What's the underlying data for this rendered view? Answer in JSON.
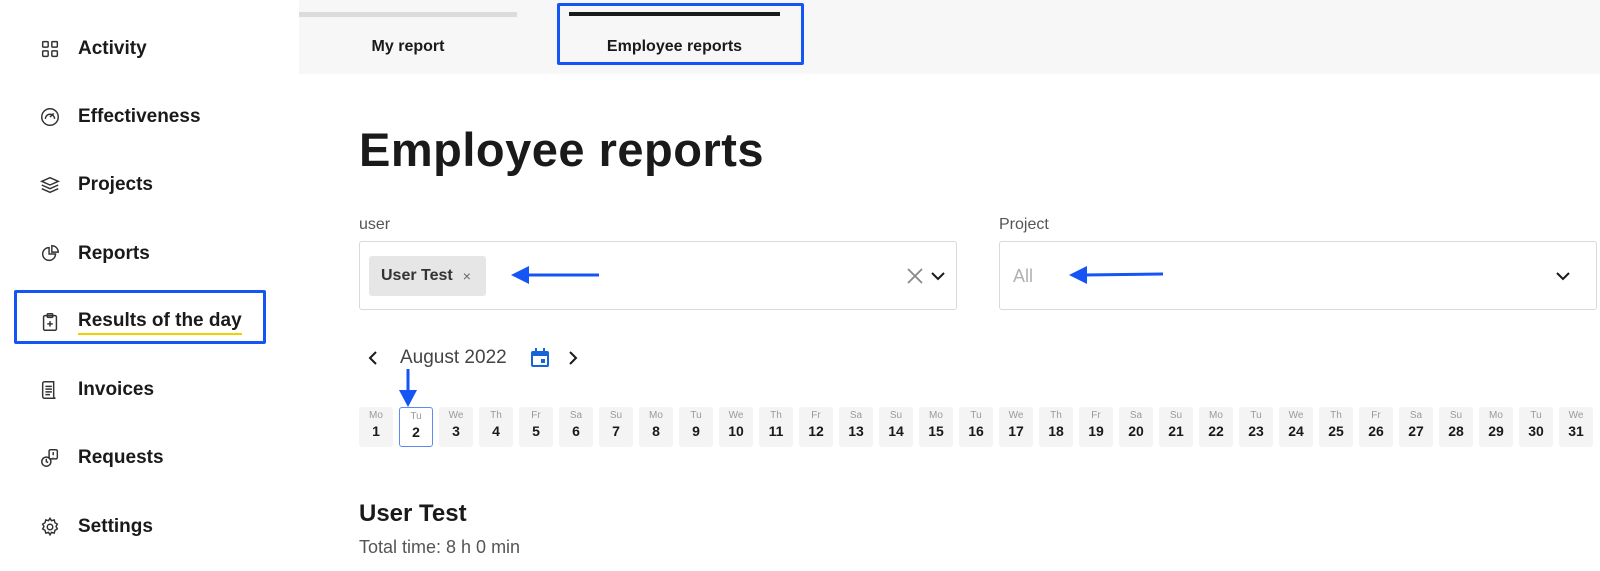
{
  "sidebar": {
    "items": [
      {
        "label": "Activity",
        "icon": "grid-icon"
      },
      {
        "label": "Effectiveness",
        "icon": "gauge-icon"
      },
      {
        "label": "Projects",
        "icon": "layers-icon"
      },
      {
        "label": "Reports",
        "icon": "pie-chart-icon"
      },
      {
        "label": "Results of the day",
        "icon": "clipboard-icon",
        "active": true
      },
      {
        "label": "Invoices",
        "icon": "receipt-icon"
      },
      {
        "label": "Requests",
        "icon": "request-icon"
      },
      {
        "label": "Settings",
        "icon": "gear-icon"
      }
    ]
  },
  "tabs": [
    {
      "label": "My report"
    },
    {
      "label": "Employee reports",
      "active": true
    }
  ],
  "page": {
    "title": "Employee reports"
  },
  "filters": {
    "user": {
      "label": "user",
      "selected": "User Test",
      "chip_remove": "×"
    },
    "project": {
      "label": "Project",
      "value": "All"
    }
  },
  "calendar": {
    "month": "August 2022",
    "selected_day": 2,
    "days": [
      {
        "n": "Mo",
        "d": "1"
      },
      {
        "n": "Tu",
        "d": "2"
      },
      {
        "n": "We",
        "d": "3"
      },
      {
        "n": "Th",
        "d": "4"
      },
      {
        "n": "Fr",
        "d": "5"
      },
      {
        "n": "Sa",
        "d": "6"
      },
      {
        "n": "Su",
        "d": "7"
      },
      {
        "n": "Mo",
        "d": "8"
      },
      {
        "n": "Tu",
        "d": "9"
      },
      {
        "n": "We",
        "d": "10"
      },
      {
        "n": "Th",
        "d": "11"
      },
      {
        "n": "Fr",
        "d": "12"
      },
      {
        "n": "Sa",
        "d": "13"
      },
      {
        "n": "Su",
        "d": "14"
      },
      {
        "n": "Mo",
        "d": "15"
      },
      {
        "n": "Tu",
        "d": "16"
      },
      {
        "n": "We",
        "d": "17"
      },
      {
        "n": "Th",
        "d": "18"
      },
      {
        "n": "Fr",
        "d": "19"
      },
      {
        "n": "Sa",
        "d": "20"
      },
      {
        "n": "Su",
        "d": "21"
      },
      {
        "n": "Mo",
        "d": "22"
      },
      {
        "n": "Tu",
        "d": "23"
      },
      {
        "n": "We",
        "d": "24"
      },
      {
        "n": "Th",
        "d": "25"
      },
      {
        "n": "Fr",
        "d": "26"
      },
      {
        "n": "Sa",
        "d": "27"
      },
      {
        "n": "Su",
        "d": "28"
      },
      {
        "n": "Mo",
        "d": "29"
      },
      {
        "n": "Tu",
        "d": "30"
      },
      {
        "n": "We",
        "d": "31"
      }
    ]
  },
  "report": {
    "user_name": "User Test",
    "total_time": "Total time: 8 h 0 min"
  },
  "colors": {
    "highlight": "#1554f5",
    "active_underline": "#f5d000",
    "calendar_icon": "#1565d8"
  }
}
